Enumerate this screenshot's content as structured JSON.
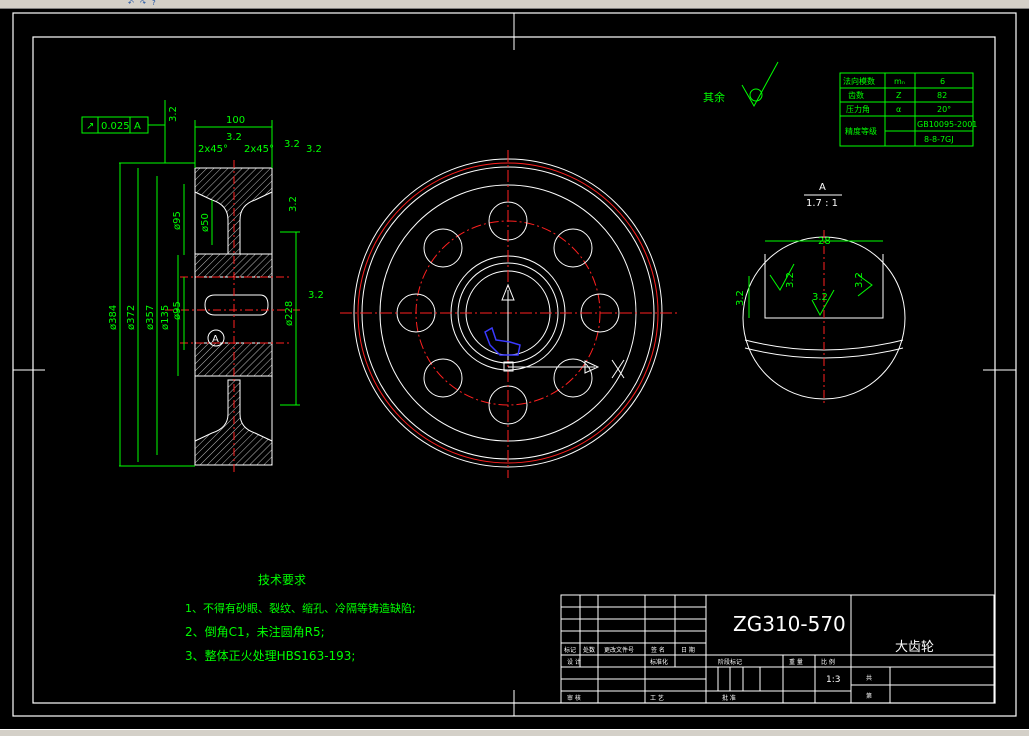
{
  "toolbar": {
    "icons": [
      "undo-icon",
      "redo-icon",
      "help-icon"
    ]
  },
  "colors": {
    "frame": "#ffffff",
    "dim": "#00ff00",
    "center": "#ff2020",
    "hatch": "#bbbbbb",
    "blue": "#3a3aff",
    "title": "#ffffff"
  },
  "tolerance": {
    "sym": "↗",
    "value": "0.025",
    "datum": "A"
  },
  "section": {
    "width_dim": "100",
    "chamfer_left": "2x45°",
    "chamfer_right": "2x45°",
    "roughness": [
      "3.2",
      "3.2",
      "3.2",
      "3.2",
      "3.2",
      "3.2",
      "3.2"
    ],
    "diameters": [
      "ø384",
      "ø372",
      "ø357",
      "ø135",
      "ø95",
      "ø95",
      "ø50",
      "ø228"
    ],
    "detail_marker": "A"
  },
  "general_roughness": {
    "label": "其余"
  },
  "param_table": {
    "rows": [
      [
        "法向模数",
        "mₙ",
        "6"
      ],
      [
        "齿数",
        "Z",
        "82"
      ],
      [
        "压力角",
        "α",
        "20°"
      ],
      [
        "精度等级",
        "",
        "GB10095-2001"
      ],
      [
        "",
        "",
        "8-8-7GJ"
      ]
    ]
  },
  "detail": {
    "label": "A",
    "scale": "1.7 : 1",
    "width": "28",
    "r1": "3.2",
    "r2": "3.2",
    "r3": "3.2",
    "r4": "3.2"
  },
  "notes": {
    "title": "技术要求",
    "items": [
      "1、不得有砂眼、裂纹、缩孔、冷隔等铸造缺陷;",
      "2、倒角C1，未注圆角R5;",
      "3、整体正火处理HBS163-193;"
    ]
  },
  "title_block": {
    "material": "ZG310-570",
    "part_name": "大齿轮",
    "scale": "1:3",
    "cells": [
      "标记",
      "处数",
      "更改文件号",
      "签 名",
      "日 期",
      "设 计",
      "标准化",
      "阶段标记",
      "重 量",
      "比 例",
      "审 核",
      "工 艺",
      "批 准",
      "共",
      "第"
    ]
  }
}
